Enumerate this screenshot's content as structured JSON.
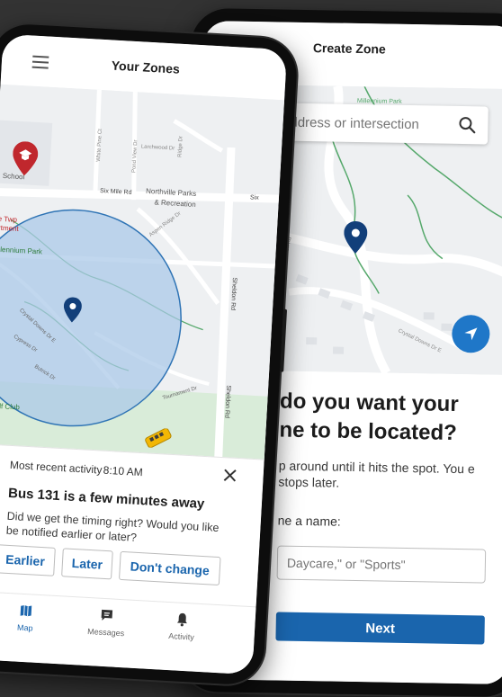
{
  "create_zone": {
    "title": "Create Zone",
    "search_placeholder": "ddress or intersection",
    "map_labels": {
      "park": "Millennium Park",
      "road1": "Sheldon Rd",
      "road2": "Crystal Downs Dr E"
    },
    "heading_line1": "do you want your",
    "heading_line2": "ne to be located?",
    "description": "p around until it hits the spot. You e stops later.",
    "name_label": "ne a name:",
    "name_placeholder": "Daycare,\" or \"Sports\"",
    "next_label": "Next"
  },
  "your_zones": {
    "title": "Your Zones",
    "map_labels": {
      "school": "School",
      "six_mile": "Six Mile Rd",
      "northville_parks": "Northville Parks",
      "recreation": "& Recreation",
      "twp": "lle Twp",
      "artment": "artment",
      "millennium": "lennium Park",
      "sheldon": "Sheldon Rd",
      "golf": "Golf Club",
      "six": "Six",
      "ridge": "Ridge Dr",
      "aspen_ridge": "Aspen Ridge Dr",
      "larchwood": "Larchwood Dr",
      "white_pine": "White Pine Ct",
      "pond_view": "Pond View Dr",
      "crystal_downs": "Crystal Downs Dr E",
      "tournament": "Tournament Dr",
      "cypress": "Cypress Dr",
      "butrick": "Butrick Dr"
    },
    "activity_card": {
      "recent_label": "Most recent activity",
      "time": "8:10 AM",
      "bus_title": "Bus 131 is a few minutes away",
      "question": "Did we get the timing right? Would you like be notified earlier or later?",
      "earlier": "Earlier",
      "later": "Later",
      "dont_change": "Don't change"
    },
    "tabs": [
      {
        "label": "Map",
        "icon": "map-icon",
        "active": true
      },
      {
        "label": "Messages",
        "icon": "messages-icon",
        "active": false
      },
      {
        "label": "Activity",
        "icon": "bell-icon",
        "active": false
      }
    ]
  },
  "colors": {
    "accent": "#1a65ad",
    "zone_fill": "#a9c8e8",
    "pin_blue": "#123f7a",
    "pin_red": "#c0272d",
    "bus_yellow": "#f2b705",
    "background": "#333333"
  }
}
